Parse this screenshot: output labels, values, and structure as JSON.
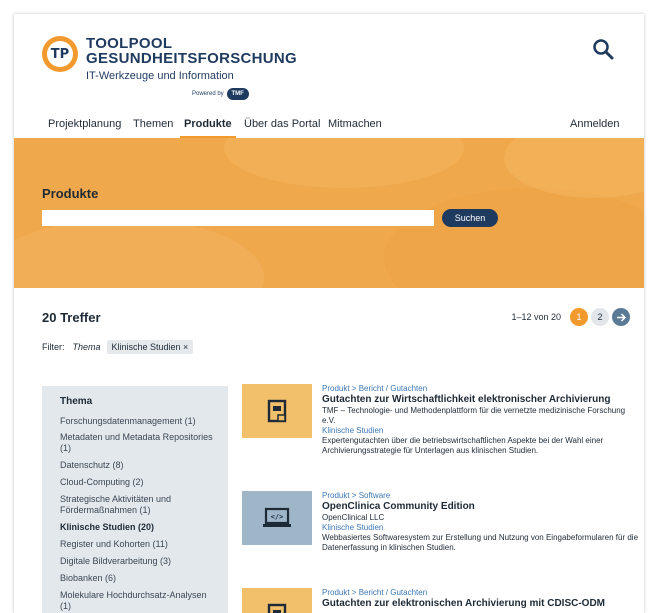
{
  "logo": {
    "line1": "TOOLPOOL",
    "line2": "GESUNDHEITSFORSCHUNG",
    "line3": "IT-Werkzeuge und Information",
    "mark": "TP",
    "powered": "Powered by",
    "tmf": "TMF"
  },
  "nav": {
    "items": [
      "Projektplanung",
      "Themen",
      "Produkte",
      "Über das Portal",
      "Mitmachen"
    ],
    "login": "Anmelden"
  },
  "hero": {
    "title": "Produkte",
    "search_placeholder": "",
    "search_button": "Suchen"
  },
  "results": {
    "count": "20 Treffer",
    "range": "1–12 von 20",
    "page1": "1",
    "page2": "2"
  },
  "filter": {
    "label": "Filter:",
    "facet": "Thema",
    "chip": "Klinische Studien ×"
  },
  "sidebar": {
    "heading": "Thema",
    "items": [
      "Forschungsdatenmanagement (1)",
      "Metadaten und Metadata Repositories (1)",
      "Datenschutz (8)",
      "Cloud-Computing (2)",
      "Strategische Aktivitäten und Fördermaßnahmen (1)",
      "Klinische Studien (20)",
      "Register und Kohorten (11)",
      "Digitale Bildverarbeitung (3)",
      "Biobanken (6)",
      "Molekulare Hochdurchsatz-Analysen (1)"
    ]
  },
  "cards": [
    {
      "category": "Produkt > Bericht / Gutachten",
      "title": "Gutachten zur Wirtschaftlichkeit elektronischer Archivierung",
      "org": "TMF – Technologie- und Methodenplattform für die vernetzte medizinische Forschung e.V.",
      "tag": "Klinische Studien",
      "desc": "Expertengutachten über die betriebswirtschaftlichen Aspekte bei der Wahl einer Archivierungsstrategie für Unterlagen aus klinischen Studien.",
      "icon": "document-icon"
    },
    {
      "category": "Produkt > Software",
      "title": "OpenClinica Community Edition",
      "org": "OpenClinical LLC",
      "tag": "Klinische Studien",
      "desc": "Webbasiertes Softwaresystem zur Erstellung und Nutzung von Eingabeformularen für die Datenerfassung in klinischen Studien.",
      "icon": "laptop-code-icon"
    },
    {
      "category": "Produkt > Bericht / Gutachten",
      "title": "Gutachten zur elektronischen Archivierung mit CDISC-ODM",
      "icon": "document-icon"
    }
  ],
  "colors": {
    "accent": "#f29a2e",
    "navy": "#1e3a5f",
    "link": "#3c78b4"
  }
}
